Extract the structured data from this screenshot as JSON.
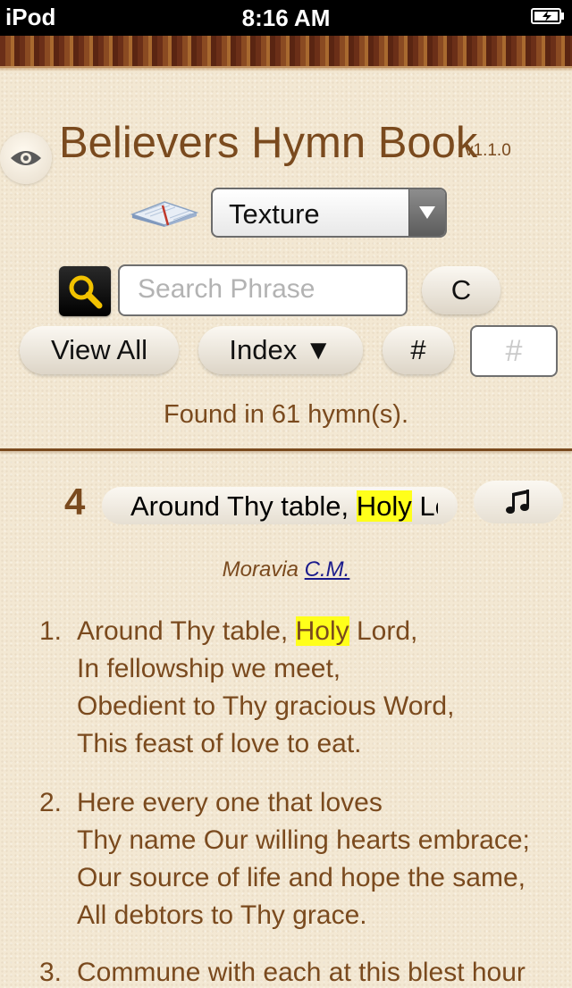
{
  "status_bar": {
    "carrier": "iPod",
    "time": "8:16 AM"
  },
  "header": {
    "title": "Believers Hymn Book",
    "version": "v1.1.0"
  },
  "theme_select": {
    "selected": "Texture"
  },
  "search": {
    "placeholder": "Search Phrase",
    "value": "",
    "clear_label": "C"
  },
  "buttons": {
    "view_all": "View All",
    "index": "Index ▼",
    "hash": "#"
  },
  "number_field": {
    "placeholder": "#",
    "value": ""
  },
  "results": {
    "found_text": "Found in 61 hymn(s)."
  },
  "hymn": {
    "number": "4",
    "title_before": "Around Thy table, ",
    "title_highlight": "Holy",
    "title_after": " Lord,",
    "tune_name": "Moravia",
    "meter": "C.M.",
    "verses": [
      {
        "num": "1.",
        "lines": [
          {
            "before": "Around Thy table, ",
            "highlight": "Holy",
            "after": " Lord,"
          },
          {
            "text": "In fellowship we meet,"
          },
          {
            "text": "Obedient to Thy gracious Word,"
          },
          {
            "text": "This feast of love to eat."
          }
        ]
      },
      {
        "num": "2.",
        "lines": [
          {
            "text": "Here every one that loves"
          },
          {
            "text": "Thy name Our willing hearts embrace;"
          },
          {
            "text": "Our source of life and hope the same,"
          },
          {
            "text": "All debtors to Thy grace."
          }
        ]
      },
      {
        "num": "3.",
        "lines": [
          {
            "text": "Commune with each at this blest hour"
          }
        ]
      }
    ]
  },
  "colors": {
    "accent_brown": "#7a4a1e",
    "highlight": "#ffff1a",
    "link": "#1a1a8c"
  }
}
